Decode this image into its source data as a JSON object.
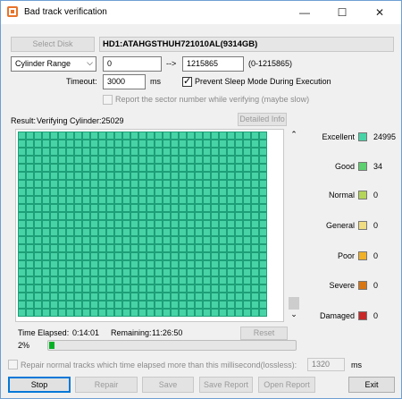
{
  "window": {
    "title": "Bad track verification",
    "minimize": "—",
    "maximize": "☐",
    "close": "✕"
  },
  "disk": {
    "select_label": "Select Disk",
    "name": "HD1:ATAHGSTHUH721010AL(9314GB)"
  },
  "range": {
    "mode": "Cylinder Range",
    "dropdown_arrow": "⌵",
    "start": "0",
    "arrow": "-->",
    "end": "1215865",
    "hint": "(0-1215865)"
  },
  "timeout": {
    "label": "Timeout:",
    "value": "3000",
    "unit": "ms"
  },
  "prevent_sleep": {
    "label": "Prevent Sleep Mode During Execution",
    "checked": true
  },
  "report_sector": {
    "label": "Report the sector number while verifying (maybe slow)",
    "checked": false
  },
  "result": {
    "label": "Result:",
    "text": "Verifying Cylinder:25029",
    "detailed_label": "Detailed Info"
  },
  "scrollbar": {
    "up_arrow": "⌃",
    "down_arrow": "⌄"
  },
  "grid": {
    "visible_cells": 713,
    "status": "Excellent"
  },
  "legend": [
    {
      "name": "Excellent",
      "count": "24995",
      "color": "#48d3a6"
    },
    {
      "name": "Good",
      "count": "34",
      "color": "#5ccf6e"
    },
    {
      "name": "Normal",
      "count": "0",
      "color": "#b4d45a"
    },
    {
      "name": "General",
      "count": "0",
      "color": "#f0dc82"
    },
    {
      "name": "Poor",
      "count": "0",
      "color": "#f0b028"
    },
    {
      "name": "Severe",
      "count": "0",
      "color": "#d87614"
    },
    {
      "name": "Damaged",
      "count": "0",
      "color": "#c82828"
    }
  ],
  "timing": {
    "elapsed_label": "Time Elapsed:",
    "elapsed": "0:14:01",
    "remaining_label": "Remaining:",
    "remaining": "11:26:50",
    "reset_label": "Reset"
  },
  "progress": {
    "percent_label": "2%",
    "value": 0.02
  },
  "repair_option": {
    "label": "Repair normal tracks which time elapsed more than this millisecond(lossless):",
    "value": "1320",
    "unit": "ms"
  },
  "buttons": {
    "stop": "Stop",
    "repair": "Repair",
    "save": "Save",
    "save_report": "Save Report",
    "open_report": "Open Report",
    "exit": "Exit"
  }
}
